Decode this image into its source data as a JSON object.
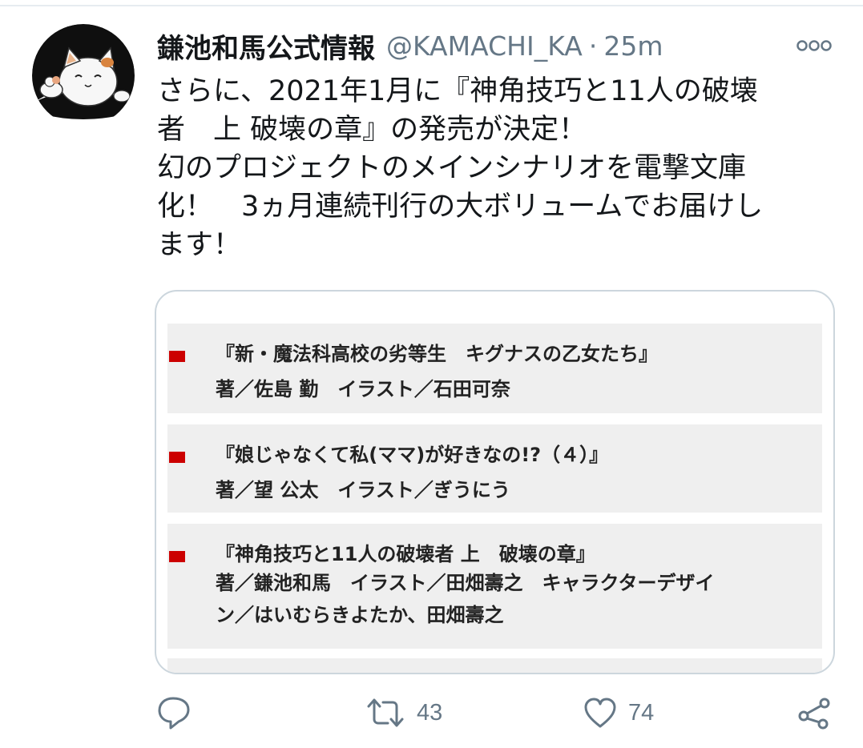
{
  "tweet": {
    "display_name": "鎌池和馬公式情報",
    "handle": "@KAMACHI_KA",
    "separator": "·",
    "timestamp": "25m",
    "text": "さらに、2021年1月に『神角技巧と11人の破壊\n者　上 破壊の章』の発売が決定！\n幻のプロジェクトのメインシナリオを電撃文庫\n化！　3ヵ月連続刊行の大ボリュームでお届けし\nます！"
  },
  "media": {
    "books": [
      {
        "title": "『新・魔法科高校の劣等生　キグナスの乙女たち』",
        "credits": "著／佐島 勤　イラスト／石田可奈"
      },
      {
        "title": "『娘じゃなくて私(ママ)が好きなの!?（４）』",
        "credits": "著／望 公太　イラスト／ぎうにう"
      },
      {
        "title": "『神角技巧と11人の破壊者 上　破壊の章』",
        "credits": "著／鎌池和馬　イラスト／田畑壽之　キャラクターデザイ\nン／はいむらきよたか、田畑壽之"
      }
    ],
    "marker_color": "#cc0000"
  },
  "actions": {
    "reply_icon": "reply-icon",
    "retweet_icon": "retweet-icon",
    "retweet_count": "43",
    "like_icon": "heart-icon",
    "like_count": "74",
    "share_icon": "share-icon"
  },
  "colors": {
    "text": "#14171a",
    "secondary": "#657786",
    "border": "#ccd6dd"
  }
}
